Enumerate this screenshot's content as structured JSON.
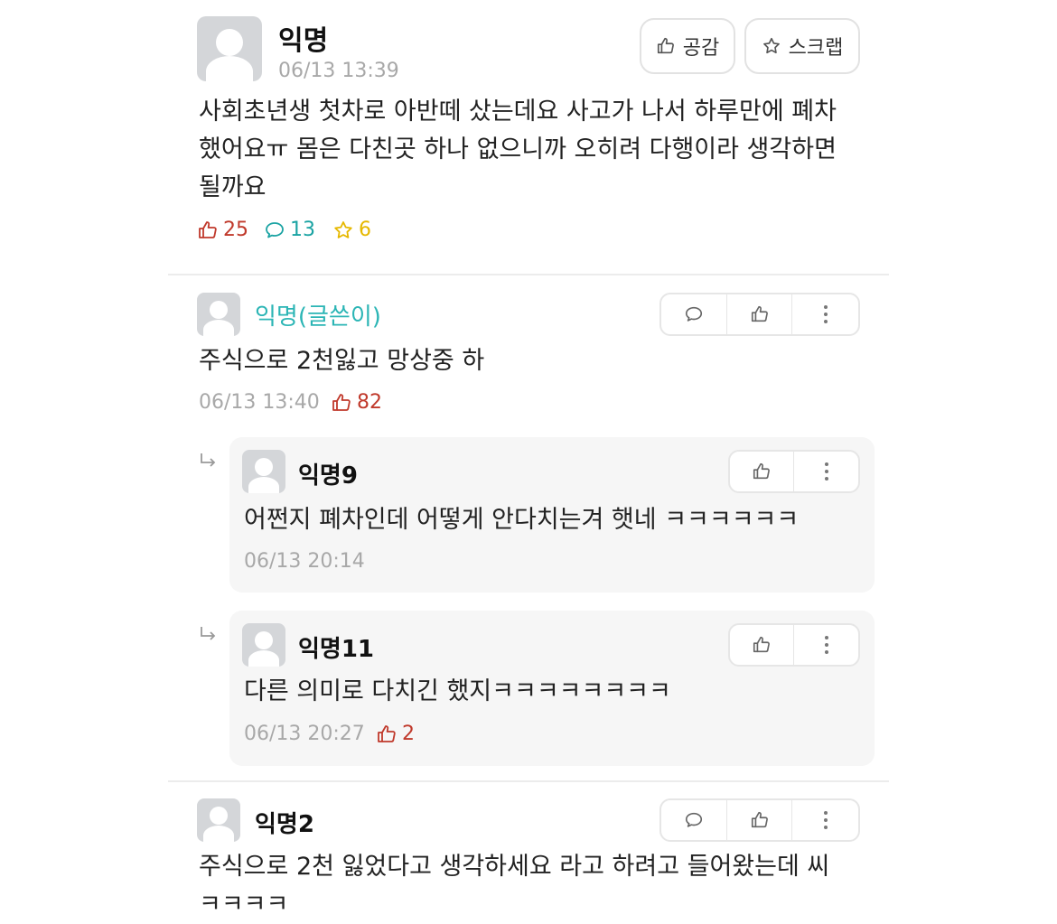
{
  "post": {
    "author": "익명",
    "time": "06/13 13:39",
    "empathy_label": "공감",
    "scrap_label": "스크랩",
    "body_lines": [
      "사회초년생 첫차로 아반떼 샀는데요 사고가 나서 하루만에 폐차",
      "했어요ㅠ 몸은 다친곳 하나 없으니까 오히려 다행이라 생각하면",
      "될까요"
    ],
    "likes": "25",
    "comments": "13",
    "scraps": "6"
  },
  "comments": [
    {
      "author": "익명(글쓴이)",
      "text": "주식으로 2천잃고 망상중 하",
      "time": "06/13 13:40",
      "likes": "82"
    },
    {
      "author": "익명2",
      "text_lines": [
        "주식으로 2천 잃었다고 생각하세요 라고 하려고 들어왔는데 씨",
        "ㅋㅋㅋㅋ"
      ]
    }
  ],
  "replies": [
    {
      "author": "익명9",
      "text": "어쩐지 폐차인데 어떻게 안다치는겨 햇네 ㅋㅋㅋㅋㅋㅋ",
      "time": "06/13 20:14"
    },
    {
      "author": "익명11",
      "text": "다른 의미로 다치긴 했지ㅋㅋㅋㅋㅋㅋㅋㅋ",
      "time": "06/13 20:27",
      "likes": "2"
    }
  ],
  "colors": {
    "like_red": "#c0392b",
    "comment_teal": "#1aa3a3",
    "scrap_yellow": "#e6b800",
    "author_teal": "#2bb5b5"
  },
  "icons": [
    "thumbs-up-icon",
    "comment-bubble-icon",
    "star-icon",
    "more-vertical-icon",
    "reply-arrow-icon"
  ]
}
